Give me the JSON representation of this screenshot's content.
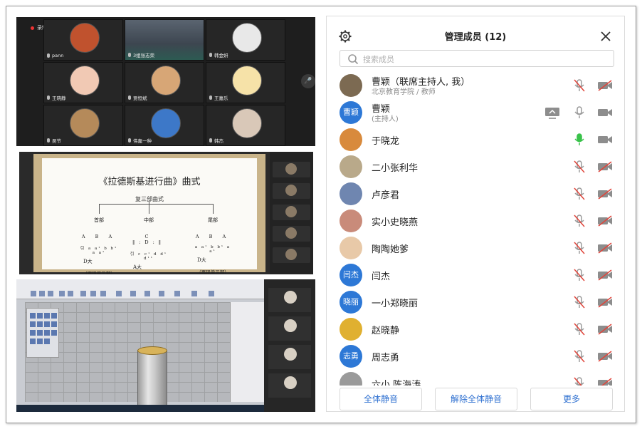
{
  "video_grid": {
    "recording_label": "录制中",
    "tiles": [
      {
        "name": "pann"
      },
      {
        "name": "3组张志荣"
      },
      {
        "name": "韩金妍"
      },
      {
        "name": "王晓静"
      },
      {
        "name": "贾恒斌"
      },
      {
        "name": "王嘉乐"
      },
      {
        "name": "吴节"
      },
      {
        "name": "伟嘉一种"
      },
      {
        "name": "韩杰"
      }
    ]
  },
  "slide": {
    "title": "《拉德斯基进行曲》曲式",
    "form": "复三部曲式",
    "sections": [
      {
        "name": "首部",
        "labels": "A B A",
        "notes": "引 a a¹ b b¹ a a¹",
        "key": "D大",
        "note": "（再现单三部）"
      },
      {
        "name": "中部",
        "labels": "C ‖:D:‖",
        "notes": "引 c c¹ d d¹ d¹¹",
        "key": "A大",
        "note": "（再现单二部）"
      },
      {
        "name": "尾部",
        "labels": "A B A",
        "notes": "a a¹ b b¹ a a¹",
        "key": "D大",
        "note": "（再现单三部）"
      }
    ]
  },
  "panel": {
    "title": "管理成员 (12)",
    "search_placeholder": "搜索成员",
    "members": [
      {
        "name": "曹颖（联席主持人, 我）",
        "sub": "北京教育学院 / 教师",
        "avatar": "photo",
        "mic": "muted",
        "video": "off"
      },
      {
        "name": "曹颖",
        "sub": "(主持人)",
        "avatar": "曹颖",
        "share": true,
        "mic": "on-gray",
        "video": "on"
      },
      {
        "name": "于晓龙",
        "sub": "",
        "avatar": "photo",
        "mic": "speaking",
        "video": "on"
      },
      {
        "name": "二小张利华",
        "sub": "",
        "avatar": "photo",
        "mic": "muted",
        "video": "off"
      },
      {
        "name": "卢彦君",
        "sub": "",
        "avatar": "photo",
        "mic": "muted",
        "video": "off"
      },
      {
        "name": "实小史晓燕",
        "sub": "",
        "avatar": "photo",
        "mic": "muted",
        "video": "off"
      },
      {
        "name": "陶陶她爹",
        "sub": "",
        "avatar": "photo",
        "mic": "muted",
        "video": "off"
      },
      {
        "name": "闫杰",
        "sub": "",
        "avatar": "闫杰",
        "mic": "muted",
        "video": "off"
      },
      {
        "name": "一小郑晓丽",
        "sub": "",
        "avatar": "晓丽",
        "mic": "muted",
        "video": "off"
      },
      {
        "name": "赵晓静",
        "sub": "",
        "avatar": "photo",
        "mic": "muted",
        "video": "off"
      },
      {
        "name": "周志勇",
        "sub": "",
        "avatar": "志勇",
        "mic": "muted",
        "video": "off"
      },
      {
        "name": "六小 陈海涛",
        "sub": "",
        "avatar": "photo",
        "mic": "muted",
        "video": "off"
      }
    ],
    "buttons": {
      "mute_all": "全体静音",
      "unmute_all": "解除全体静音",
      "more": "更多"
    }
  },
  "colors": {
    "accent": "#2d6fd0",
    "avatar_blue": "#2d78d6",
    "muted_red": "#e0443a",
    "speaking_green": "#39c24a"
  }
}
